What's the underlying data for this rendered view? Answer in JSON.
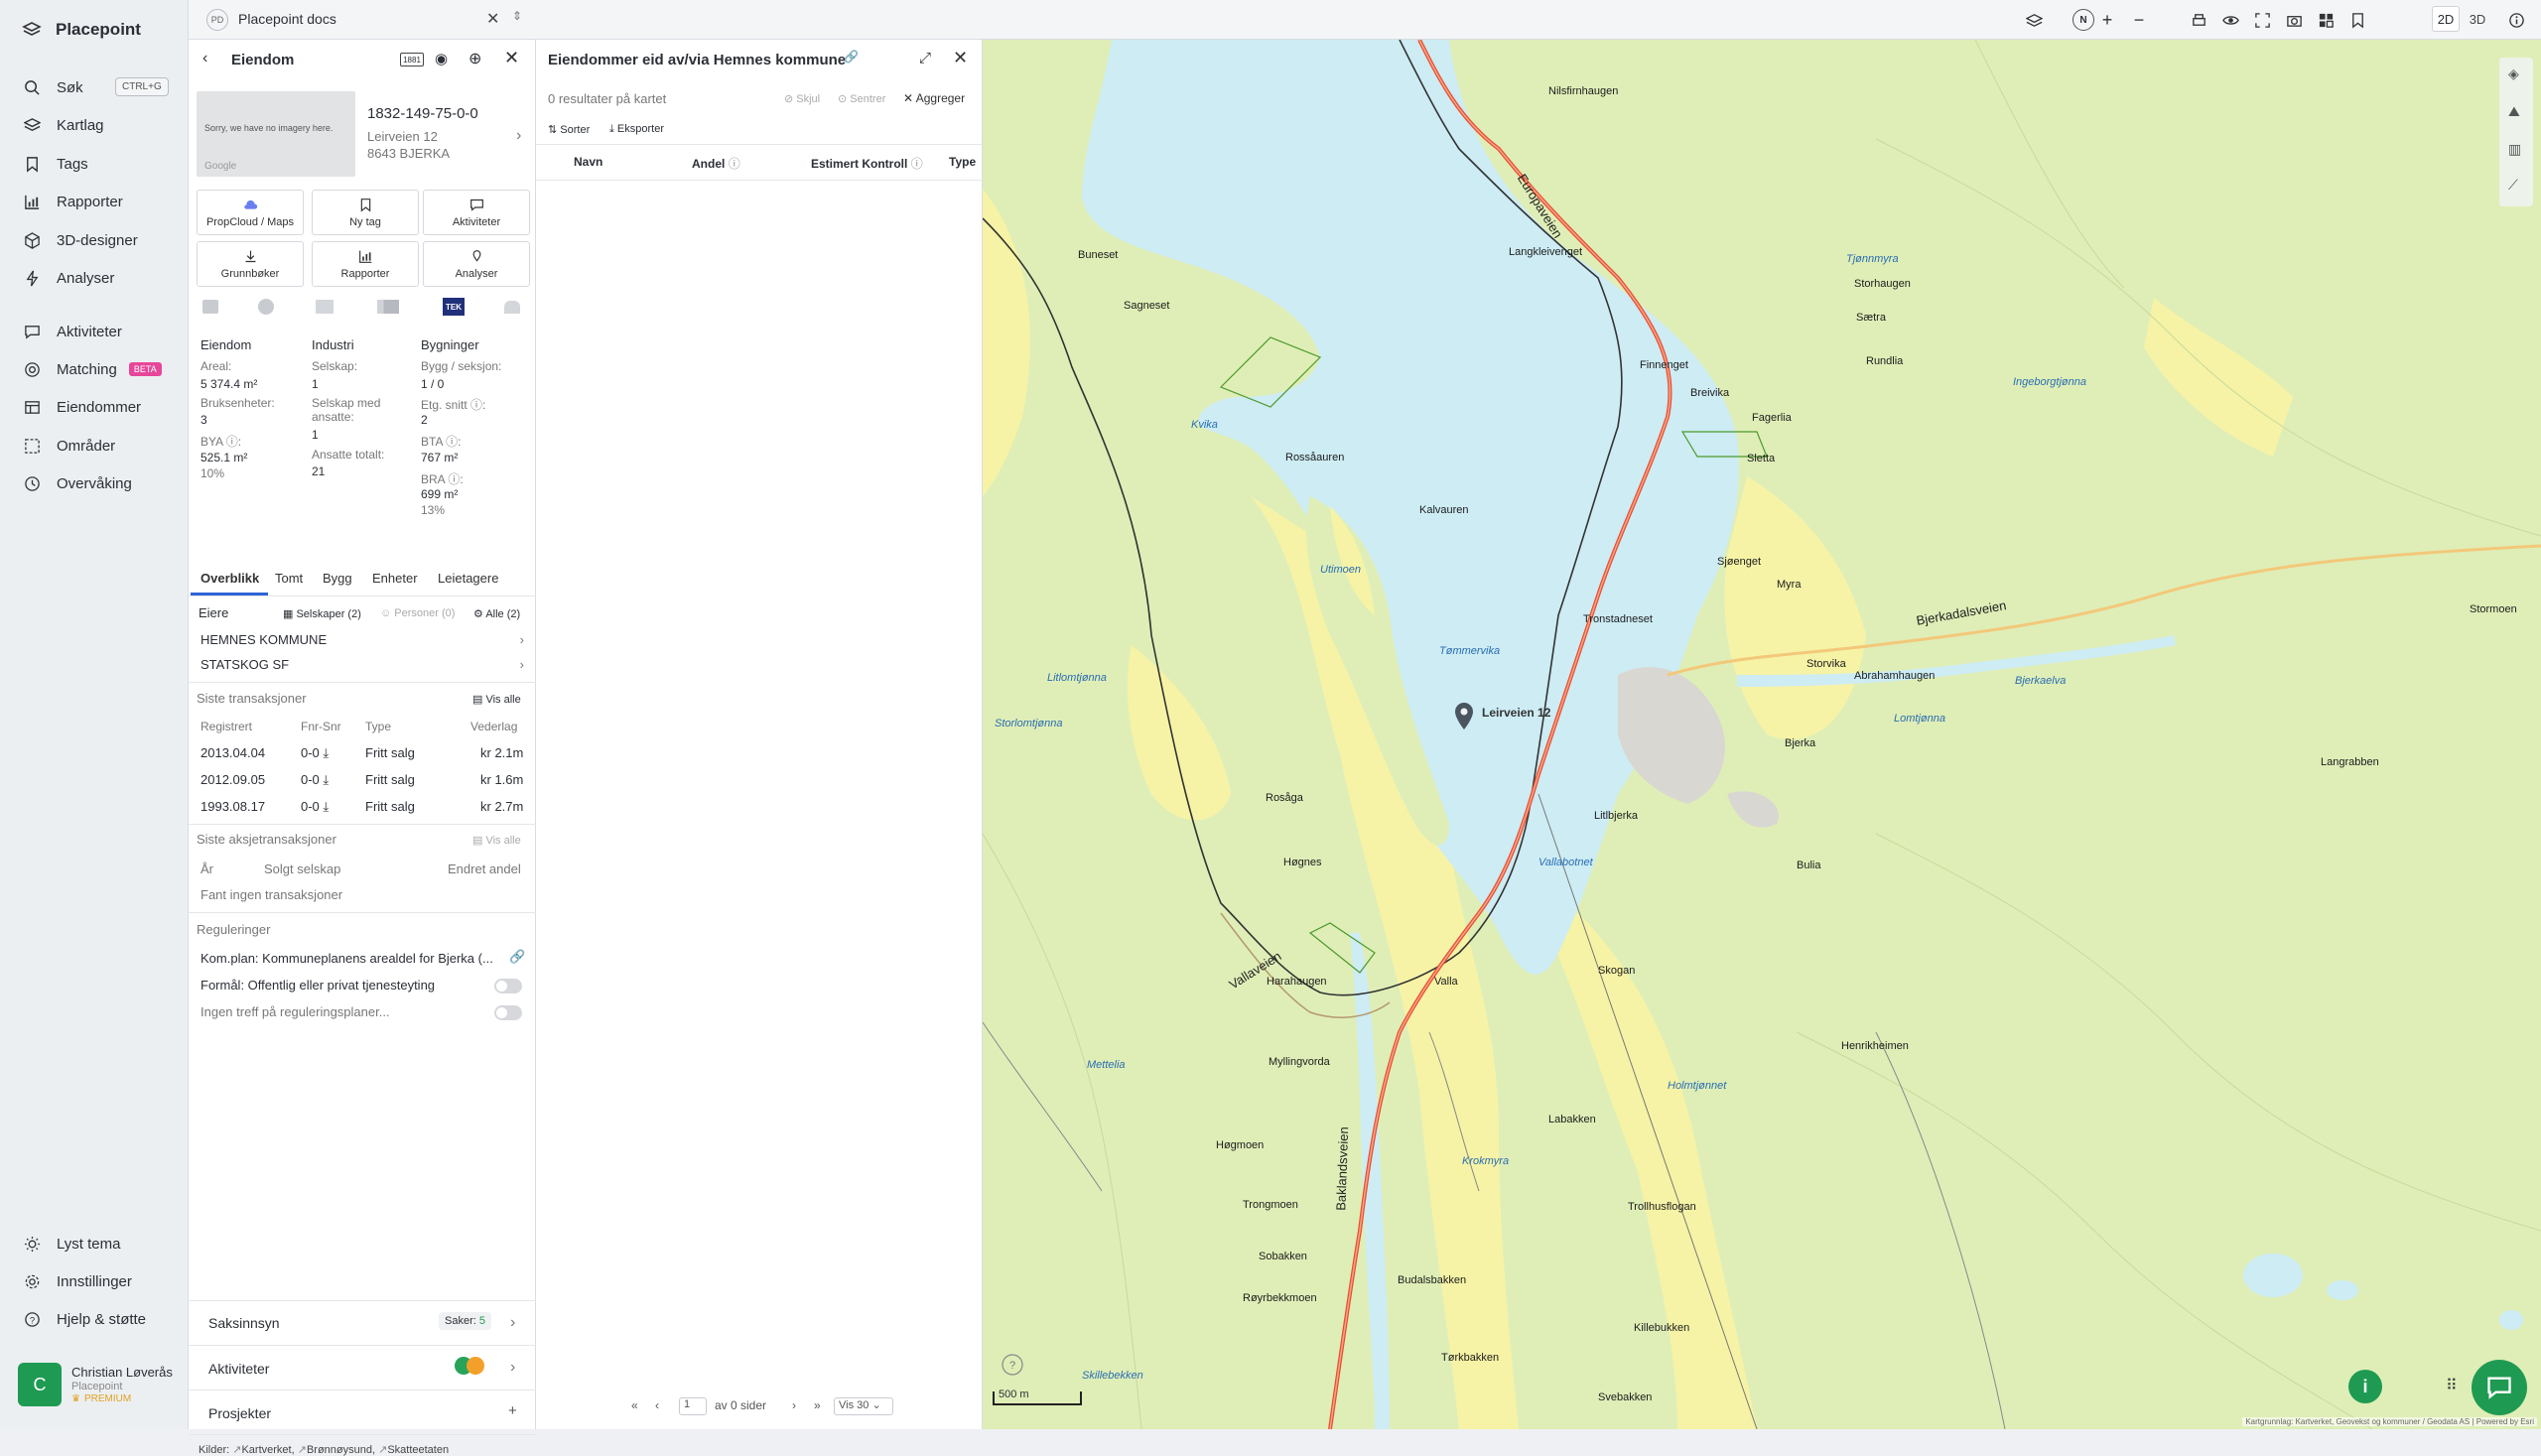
{
  "nav": {
    "brand": "Placepoint",
    "items": [
      {
        "label": "Søk",
        "icon": "search-icon"
      },
      {
        "label": "Kartlag",
        "icon": "layers-icon"
      },
      {
        "label": "Tags",
        "icon": "bookmark-icon"
      },
      {
        "label": "Rapporter",
        "icon": "chart-icon"
      },
      {
        "label": "3D-designer",
        "icon": "cube-icon"
      },
      {
        "label": "Analyser",
        "icon": "bolt-icon"
      },
      {
        "label": "Aktiviteter",
        "icon": "chat-icon"
      },
      {
        "label": "Matching",
        "icon": "target-icon"
      },
      {
        "label": "Eiendommer",
        "icon": "table-icon"
      },
      {
        "label": "Områder",
        "icon": "dashed-square-icon"
      },
      {
        "label": "Overvåking",
        "icon": "clock-icon"
      }
    ],
    "search_shortcut": "CTRL+G",
    "matching_badge": "BETA",
    "bottom": [
      {
        "label": "Lyst tema",
        "icon": "sun-icon"
      },
      {
        "label": "Innstillinger",
        "icon": "gear-icon"
      },
      {
        "label": "Hjelp & støtte",
        "icon": "help-icon"
      }
    ],
    "user": {
      "initial": "C",
      "name": "Christian Løverås",
      "org": "Placepoint",
      "plan": "PREMIUM"
    }
  },
  "tabbar": {
    "badge": "PD",
    "title": "Placepoint docs"
  },
  "property": {
    "header": "Eiendom",
    "id": "1832-149-75-0-0",
    "address1": "Leirveien 12",
    "address2": "8643 BJERKA",
    "no_imagery": "Sorry, we have no imagery here.",
    "google": "Google",
    "actions": [
      "PropCloud / Maps",
      "Ny tag",
      "Aktiviteter",
      "Grunnbøker",
      "Rapporter",
      "Analyser"
    ],
    "stats": {
      "col1": {
        "title": "Eiendom",
        "areal_label": "Areal:",
        "areal": "5 374.4 m²",
        "bruks_label": "Bruksenheter:",
        "bruks": "3",
        "bya_label": "BYA ⓘ:",
        "bya": "525.1 m²",
        "bya_pct": "10%"
      },
      "col2": {
        "title": "Industri",
        "selskap_label": "Selskap:",
        "selskap": "1",
        "ansatte_label1": "Selskap med",
        "ansatte_label2": "ansatte:",
        "ansatte": "1",
        "totalt_label": "Ansatte totalt:",
        "totalt": "21"
      },
      "col3": {
        "title": "Bygninger",
        "bygg_label": "Bygg / seksjon:",
        "bygg": "1 / 0",
        "etg_label": "Etg. snitt ⓘ:",
        "etg": "2",
        "bta_label": "BTA ⓘ:",
        "bta": "767 m²",
        "bra_label": "BRA ⓘ:",
        "bra": "699 m²",
        "bra_pct": "13%"
      }
    },
    "tabs": [
      "Overblikk",
      "Tomt",
      "Bygg",
      "Enheter",
      "Leietagere"
    ],
    "owners_label": "Eiere",
    "owner_filters": [
      "Selskaper (2)",
      "Personer (0)",
      "Alle (2)"
    ],
    "owners": [
      "HEMNES KOMMUNE",
      "STATSKOG SF"
    ],
    "transactions": {
      "title": "Siste transaksjoner",
      "see_all": "Vis alle",
      "headers": [
        "Registrert",
        "Fnr-Snr",
        "Type",
        "Vederlag"
      ],
      "rows": [
        {
          "date": "2013.04.04",
          "fnr": "0-0",
          "type": "Fritt salg",
          "amount": "kr 2.1m"
        },
        {
          "date": "2012.09.05",
          "fnr": "0-0",
          "type": "Fritt salg",
          "amount": "kr 1.6m"
        },
        {
          "date": "1993.08.17",
          "fnr": "0-0",
          "type": "Fritt salg",
          "amount": "kr 2.7m"
        }
      ]
    },
    "share_transactions": {
      "title": "Siste aksjetransaksjoner",
      "see_all": "Vis alle",
      "headers": [
        "År",
        "Solgt selskap",
        "Endret andel"
      ],
      "empty": "Fant ingen transaksjoner"
    },
    "regulations": {
      "title": "Reguleringer",
      "plan": "Kom.plan: Kommuneplanens arealdel for Bjerka (...",
      "purpose": "Formål: Offentlig eller privat tjenesteyting",
      "none": "Ingen treff på reguleringsplaner..."
    },
    "sections": [
      {
        "label": "Saksinnsyn",
        "extra": "Saker:",
        "count": "5"
      },
      {
        "label": "Aktiviteter"
      },
      {
        "label": "Prosjekter"
      }
    ],
    "sources_label": "Kilder:",
    "sources": [
      "Kartverket",
      "Brønnøysund",
      "Skatteetaten"
    ]
  },
  "results": {
    "title": "Eiendommer eid av/via Hemnes kommune",
    "count": "0 resultater på kartet",
    "hide": "Skjul",
    "center": "Sentrer",
    "aggregate": "Aggreger",
    "sort": "Sorter",
    "export": "Eksporter",
    "columns": [
      "Navn",
      "Andel",
      "Estimert Kontroll",
      "Type"
    ],
    "pager": {
      "page": "1",
      "of": "av 0 sider",
      "per_page": "Vis 30"
    }
  },
  "map": {
    "mode_2d": "2D",
    "mode_3d": "3D",
    "scale": "500 m",
    "attribution": "Kartgrunnlag: Kartverket, Geovekst og kommuner / Geodata AS | Powered by Esri",
    "marker_label": "Leirveien 12",
    "places": [
      "Nilsfirnhaugen",
      "Buneset",
      "Sagneset",
      "Langkleivenget",
      "Finnenget",
      "Breivika",
      "Fagerlia",
      "Rossåauren",
      "Kalvauren",
      "Sjøenget",
      "Myra",
      "Tronstadneset",
      "Storvika",
      "Abrahamhaugen",
      "Bjerka",
      "Litlbjerka",
      "Rosåga",
      "Høgnes",
      "Harahaugen",
      "Valla",
      "Skogan",
      "Myllingvorda",
      "Labakken",
      "Høgmoen",
      "Trongmoen",
      "Sobakken",
      "Røyrbekkmoen",
      "Budalsbakken",
      "Tørkbakken",
      "Svebakken",
      "Killebukken",
      "Trollhusflogan",
      "Henrikheimen",
      "Bulia",
      "Storhaugen",
      "Sætra",
      "Rundlia",
      "Sletta",
      "Langrabben",
      "Stormoen"
    ],
    "waters": [
      "Kvika",
      "Utimoen",
      "Tømmervika",
      "Litlomtjønna",
      "Storlomtjønna",
      "Vallabotnet",
      "Tjønnmyra",
      "Ingeborgtjønna",
      "Lomtjønna",
      "Mettelia",
      "Holmtjønnet",
      "Skillebekken",
      "Krokmyra",
      "Bjerkaelva"
    ],
    "roads": [
      "Europaveien",
      "Vallaveien",
      "Baklandsveien",
      "Bjerkadalsveien"
    ]
  }
}
